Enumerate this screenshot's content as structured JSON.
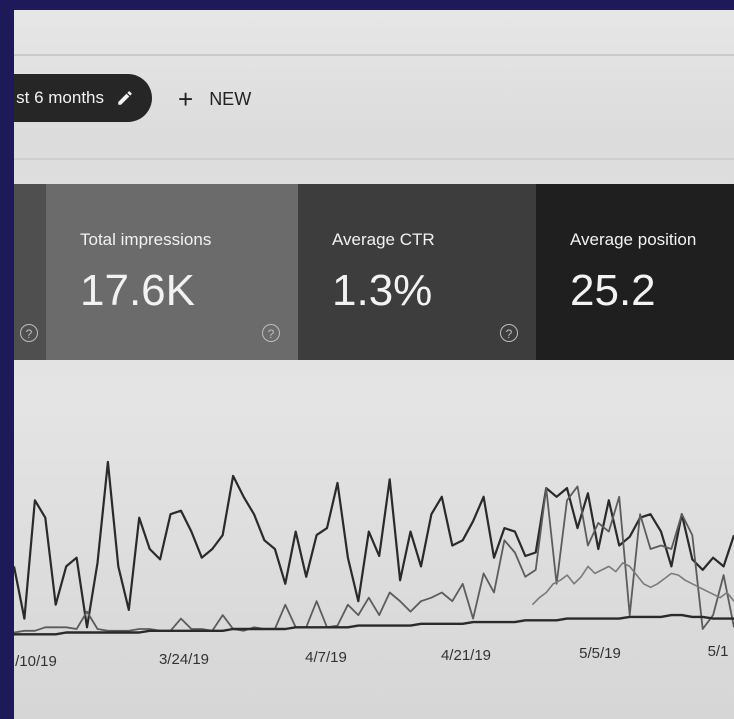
{
  "toolbar": {
    "date_range_label": "st 6 months",
    "edit_icon": "pencil-icon",
    "new_label": "NEW",
    "new_icon": "plus-icon"
  },
  "metrics": {
    "total_impressions": {
      "title": "Total impressions",
      "value": "17.6K"
    },
    "average_ctr": {
      "title": "Average CTR",
      "value": "1.3%"
    },
    "average_position": {
      "title": "Average position",
      "value": "25.2"
    },
    "help_icon": "help-circle-icon",
    "help_glyph": "?"
  },
  "colors": {
    "impressions_card": "#6b6b6b",
    "ctr_card": "#3d3d3d",
    "position_card": "#1f1f1f",
    "line_dark": "#2a2a2a",
    "line_mid": "#5c5c5c",
    "line_light": "#7a7a7a"
  },
  "chart_data": {
    "type": "line",
    "x_tick_labels": [
      "/10/19",
      "3/24/19",
      "4/7/19",
      "4/21/19",
      "5/5/19",
      "5/1"
    ],
    "grid": false,
    "legend": "none",
    "ylim": [
      0,
      1
    ],
    "series": [
      {
        "values": [
          0.4,
          0.1,
          0.78,
          0.68,
          0.18,
          0.4,
          0.45,
          0.05,
          0.42,
          1.0,
          0.4,
          0.15,
          0.68,
          0.5,
          0.44,
          0.7,
          0.72,
          0.6,
          0.45,
          0.5,
          0.58,
          0.92,
          0.8,
          0.7,
          0.55,
          0.5,
          0.3,
          0.6,
          0.34,
          0.58,
          0.62,
          0.88,
          0.45,
          0.2,
          0.6,
          0.46,
          0.9,
          0.32,
          0.6,
          0.4,
          0.7,
          0.8,
          0.52,
          0.55,
          0.66,
          0.8,
          0.45,
          0.62,
          0.6,
          0.46,
          0.48,
          0.85,
          0.8,
          0.85,
          0.62,
          0.82,
          0.5,
          0.78,
          0.52,
          0.57,
          0.68,
          0.7,
          0.6,
          0.4,
          0.7,
          0.44,
          0.38,
          0.45,
          0.4,
          0.58
        ]
      },
      {
        "values": [
          0.02,
          0.03,
          0.03,
          0.05,
          0.05,
          0.05,
          0.04,
          0.14,
          0.04,
          0.03,
          0.03,
          0.03,
          0.04,
          0.04,
          0.03,
          0.03,
          0.1,
          0.04,
          0.04,
          0.03,
          0.12,
          0.04,
          0.03,
          0.05,
          0.04,
          0.04,
          0.18,
          0.05,
          0.05,
          0.2,
          0.05,
          0.06,
          0.18,
          0.12,
          0.22,
          0.12,
          0.25,
          0.2,
          0.14,
          0.2,
          0.22,
          0.25,
          0.2,
          0.3,
          0.1,
          0.36,
          0.25,
          0.55,
          0.48,
          0.34,
          0.38,
          0.85,
          0.3,
          0.78,
          0.86,
          0.52,
          0.65,
          0.6,
          0.8,
          0.12,
          0.7,
          0.5,
          0.52,
          0.5,
          0.7,
          0.58,
          0.04,
          0.12,
          0.35,
          0.05
        ]
      },
      {
        "values": [
          0.01,
          0.01,
          0.01,
          0.01,
          0.01,
          0.02,
          0.02,
          0.02,
          0.02,
          0.02,
          0.02,
          0.02,
          0.02,
          0.03,
          0.03,
          0.03,
          0.03,
          0.03,
          0.03,
          0.03,
          0.03,
          0.04,
          0.04,
          0.04,
          0.04,
          0.04,
          0.04,
          0.05,
          0.05,
          0.05,
          0.05,
          0.05,
          0.05,
          0.06,
          0.06,
          0.06,
          0.06,
          0.06,
          0.06,
          0.07,
          0.07,
          0.07,
          0.07,
          0.07,
          0.08,
          0.08,
          0.08,
          0.08,
          0.08,
          0.09,
          0.09,
          0.09,
          0.09,
          0.1,
          0.1,
          0.1,
          0.1,
          0.1,
          0.1,
          0.11,
          0.11,
          0.11,
          0.11,
          0.12,
          0.12,
          0.11,
          0.11,
          0.1,
          0.1,
          0.1
        ]
      },
      {
        "values": [
          0.18,
          0.22,
          0.25,
          0.3,
          0.32,
          0.35,
          0.3,
          0.34,
          0.4,
          0.36,
          0.38,
          0.4,
          0.37,
          0.42,
          0.4,
          0.35,
          0.3,
          0.28,
          0.3,
          0.33,
          0.36,
          0.35,
          0.32,
          0.3,
          0.28,
          0.26,
          0.24,
          0.22,
          0.25,
          0.2
        ]
      }
    ]
  }
}
